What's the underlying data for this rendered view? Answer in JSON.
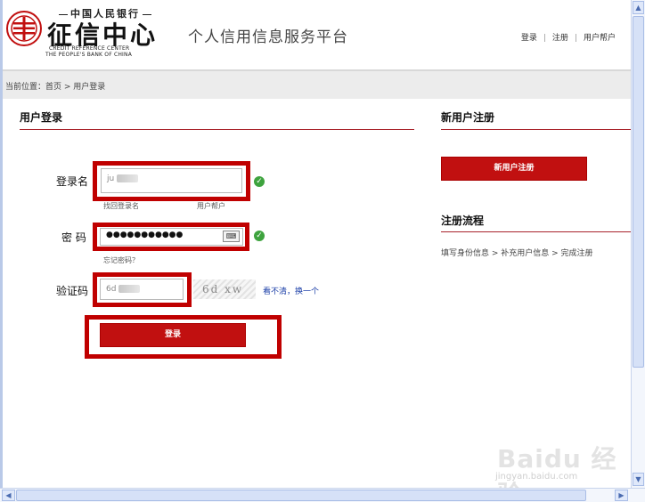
{
  "header": {
    "logo_top": "中国人民银行",
    "logo_main": "征信中心",
    "logo_en1": "CREDIT REFERENCE CENTER",
    "logo_en2": "THE PEOPLE'S BANK OF CHINA",
    "platform_title": "个人信用信息服务平台",
    "nav": {
      "login": "登录",
      "register": "注册",
      "user_guide": "用户帮户"
    }
  },
  "breadcrumb": {
    "text": "当前位置：首页 > 用户登录"
  },
  "login": {
    "section_title": "用户登录",
    "username_label": "登录名",
    "username_value": "ju",
    "find_username": "找回登录名",
    "user_help": "用户帮户",
    "password_label": "密 码",
    "password_value": "●●●●●●●●●●●",
    "forgot_password": "忘记密码？",
    "captcha_label": "验证码",
    "captcha_value": "6d",
    "captcha_image_text": "6d  xw",
    "refresh_captcha": "看不清，换一个",
    "submit_label": "登录"
  },
  "register": {
    "section_title": "新用户注册",
    "button_label": "新用户注册",
    "flow_title": "注册流程",
    "flow_steps": "填写身份信息 > 补充用户信息 > 完成注册"
  },
  "watermark": {
    "brand": "Baidu 经验",
    "url": "jingyan.baidu.com"
  },
  "colors": {
    "accent": "#c11010",
    "highlight": "#c00000",
    "check": "#3ea33e"
  }
}
